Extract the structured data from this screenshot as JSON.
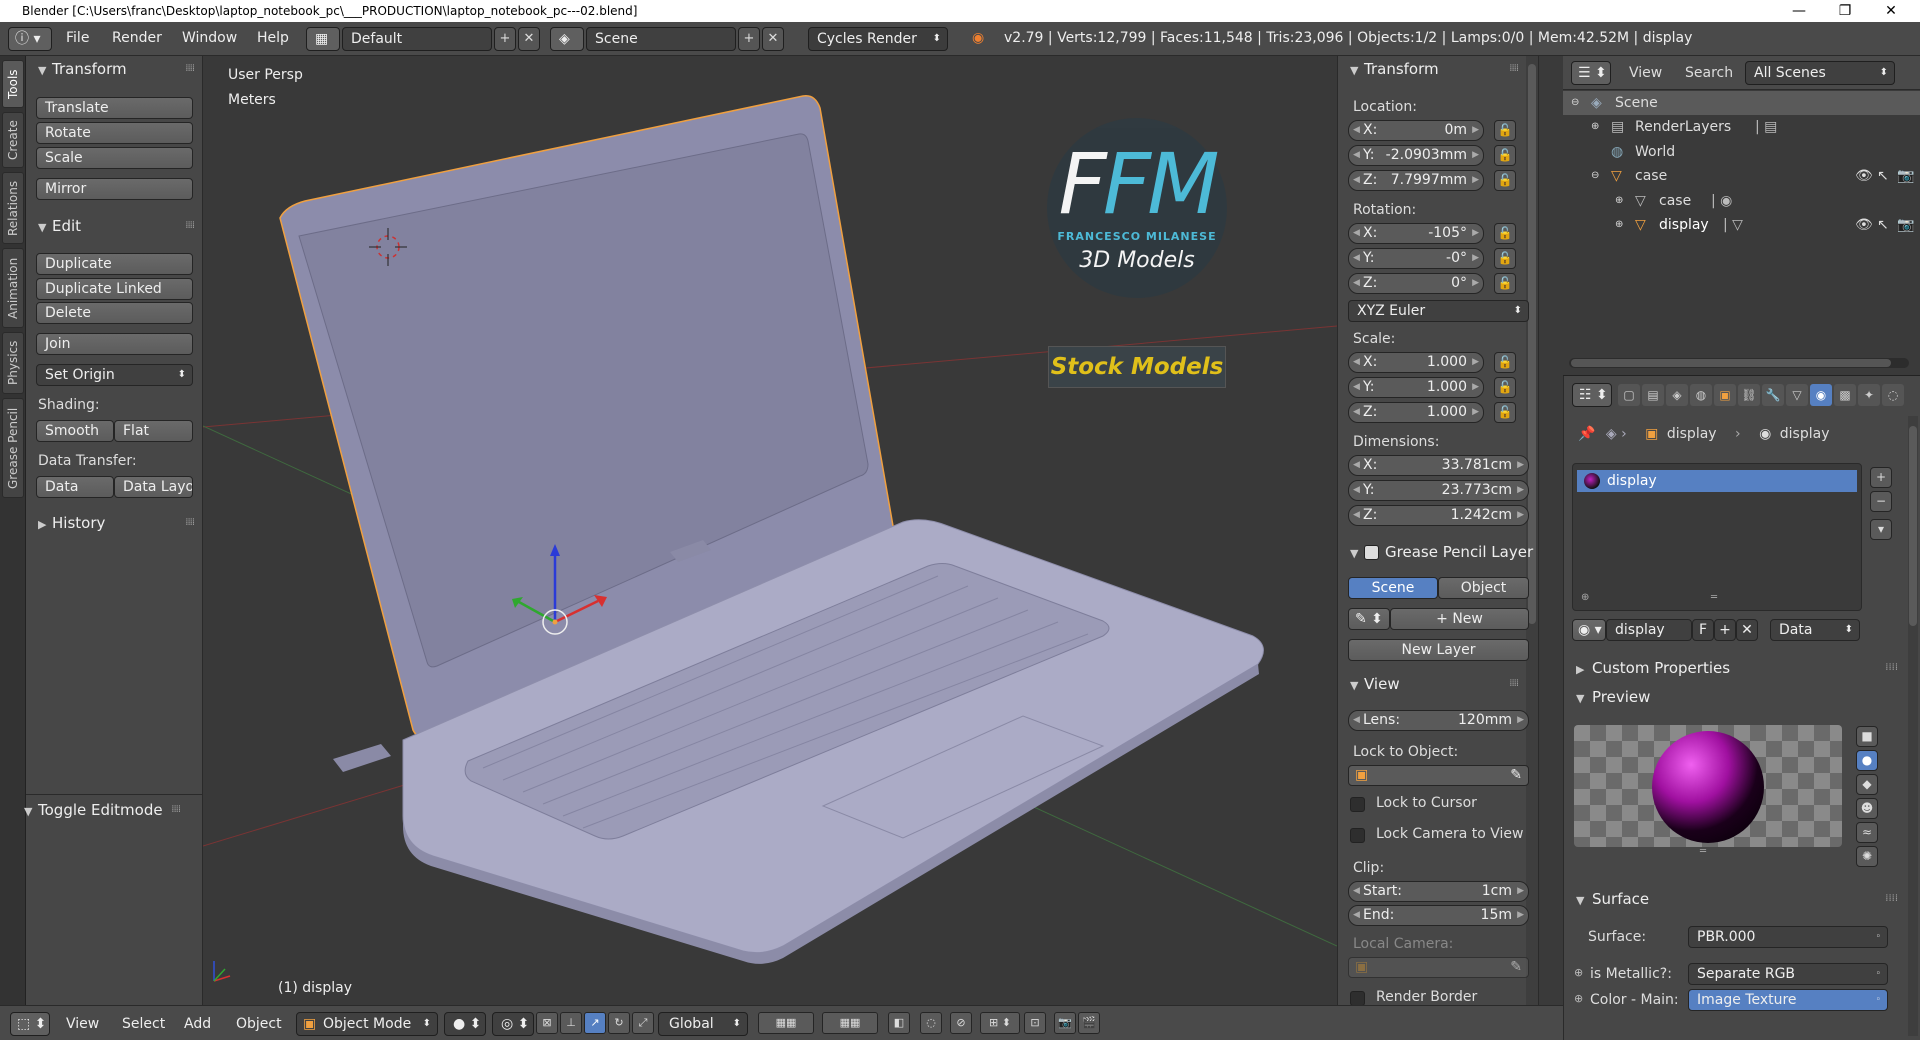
{
  "window": {
    "title": "Blender [C:\\Users\\franc\\Desktop\\laptop_notebook_pc\\___PRODUCTION\\laptop_notebook_pc---02.blend]",
    "minimize": "—",
    "maximize": "❐",
    "close": "✕"
  },
  "info_header": {
    "menus": [
      "File",
      "Render",
      "Window",
      "Help"
    ],
    "layout": "Default",
    "scene": "Scene",
    "engine": "Cycles Render",
    "stats": "v2.79 | Verts:12,799 | Faces:11,548 | Tris:23,096 | Objects:1/2 | Lamps:0/0 | Mem:42.52M | display"
  },
  "vertical_tabs": [
    "Tools",
    "Create",
    "Relations",
    "Animation",
    "Physics",
    "Grease Pencil"
  ],
  "tool_shelf": {
    "transform": {
      "title": "Transform",
      "buttons": [
        "Translate",
        "Rotate",
        "Scale",
        "Mirror"
      ]
    },
    "edit": {
      "title": "Edit",
      "buttons": [
        "Duplicate",
        "Duplicate Linked",
        "Delete",
        "Join"
      ],
      "set_origin": "Set Origin",
      "shading_label": "Shading:",
      "shading": [
        "Smooth",
        "Flat"
      ],
      "data_transfer_label": "Data Transfer:",
      "data_transfer": [
        "Data",
        "Data Layo"
      ]
    },
    "history": "History",
    "toggle_editmode": "Toggle Editmode"
  },
  "viewport": {
    "view_name": "User Persp",
    "units": "Meters",
    "object_label": "(1) display",
    "watermark": {
      "logo": "FM",
      "author": "FRANCESCO MILANESE",
      "line": "3D Models",
      "banner": "Stock Models"
    }
  },
  "n_panel": {
    "transform": "Transform",
    "location_label": "Location:",
    "location": [
      {
        "k": "X:",
        "v": "0m"
      },
      {
        "k": "Y:",
        "v": "-2.0903mm"
      },
      {
        "k": "Z:",
        "v": "7.7997mm"
      }
    ],
    "rotation_label": "Rotation:",
    "rotation": [
      {
        "k": "X:",
        "v": "-105°"
      },
      {
        "k": "Y:",
        "v": "-0°"
      },
      {
        "k": "Z:",
        "v": "0°"
      }
    ],
    "rotation_mode": "XYZ Euler",
    "scale_label": "Scale:",
    "scale": [
      {
        "k": "X:",
        "v": "1.000"
      },
      {
        "k": "Y:",
        "v": "1.000"
      },
      {
        "k": "Z:",
        "v": "1.000"
      }
    ],
    "dimensions_label": "Dimensions:",
    "dimensions": [
      {
        "k": "X:",
        "v": "33.781cm"
      },
      {
        "k": "Y:",
        "v": "23.773cm"
      },
      {
        "k": "Z:",
        "v": "1.242cm"
      }
    ],
    "grease_pencil": "Grease Pencil Layer",
    "gp_scene": "Scene",
    "gp_object": "Object",
    "gp_new": "New",
    "gp_new_layer": "New Layer",
    "view": "View",
    "lens_label": "Lens:",
    "lens": "120mm",
    "lock_to_object": "Lock to Object:",
    "lock_to_cursor": "Lock to Cursor",
    "lock_camera": "Lock Camera to View",
    "clip_label": "Clip:",
    "clip_start_label": "Start:",
    "clip_start": "1cm",
    "clip_end_label": "End:",
    "clip_end": "15m",
    "local_camera": "Local Camera:",
    "render_border": "Render Border"
  },
  "outliner": {
    "view": "View",
    "search": "Search",
    "filter": "All Scenes",
    "rows": [
      "Scene",
      "RenderLayers",
      "World",
      "case",
      "case",
      "display"
    ]
  },
  "properties": {
    "breadcrumb": [
      "display",
      "display"
    ],
    "slot": "display",
    "material_name": "display",
    "fake_user": "F",
    "link": "Data",
    "custom_properties": "Custom Properties",
    "preview": "Preview",
    "surface_section": "Surface",
    "surface_label": "Surface:",
    "surface_value": "PBR.000",
    "metallic_label": "is Metallic?:",
    "metallic_value": "Separate RGB",
    "color_label": "Color - Main:",
    "color_value": "Image Texture"
  },
  "bottom_header": {
    "menus": [
      "View",
      "Select",
      "Add",
      "Object"
    ],
    "mode": "Object Mode",
    "orientation": "Global"
  },
  "colors": {
    "selection": "#5680c2",
    "outline": "#f0a040",
    "laptop": "#a7a7c3",
    "logo_cyan": "#4fc1e0",
    "banner_yellow": "#e0c01a"
  }
}
